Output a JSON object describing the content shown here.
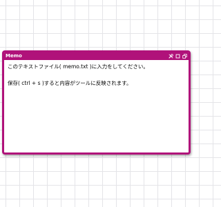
{
  "window": {
    "title": "Memo",
    "accent_color": "#b0127a",
    "icons": [
      "tools-icon",
      "maximize-icon",
      "restore-icon"
    ]
  },
  "memo": {
    "lines": [
      "このテキストファイル( memo.txt )に入力をしてください。",
      "",
      "保存( ctrl + s )すると内容がツールに反映されます。"
    ]
  }
}
